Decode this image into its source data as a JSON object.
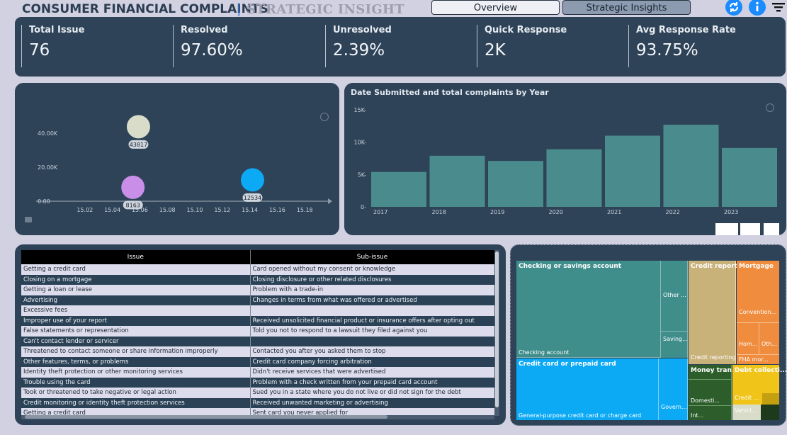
{
  "header": {
    "title": "CONSUMER FINANCIAL COMPLAINTS",
    "separator": "|",
    "subtitle": "STRATEGIC INSIGHT",
    "nav": {
      "overview": "Overview",
      "strategic": "Strategic Insights"
    },
    "icons": [
      "refresh-icon",
      "info-icon",
      "filter-icon"
    ]
  },
  "kpis": [
    {
      "label": "Total Issue",
      "value": "76"
    },
    {
      "label": "Resolved",
      "value": "97.60%"
    },
    {
      "label": "Unresolved",
      "value": "2.39%"
    },
    {
      "label": "Quick Response",
      "value": "2K"
    },
    {
      "label": "Avg Response Rate",
      "value": "93.75%"
    }
  ],
  "chart_data": [
    {
      "type": "scatter",
      "y_ticks": [
        "40.00K",
        "20.00K",
        "0.00"
      ],
      "x_ticks": [
        "15.02",
        "15.04",
        "15.06",
        "15.08",
        "15.10",
        "15.12",
        "15.14",
        "15.16",
        "15.18"
      ],
      "points": [
        {
          "x": 15.059,
          "y": 43817,
          "label": "43817",
          "color": "#d9dcc9"
        },
        {
          "x": 15.055,
          "y": 8163,
          "label": "8163",
          "color": "#c98ee8"
        },
        {
          "x": 15.142,
          "y": 12534,
          "label": "12534",
          "color": "#0ca9f5"
        }
      ],
      "xlim": [
        15.0,
        15.2
      ],
      "ylim": [
        0,
        50000
      ]
    },
    {
      "type": "bar",
      "title": "Date Submitted and total complaints by Year",
      "categories": [
        "2017",
        "2018",
        "2019",
        "2020",
        "2021",
        "2022",
        "2023"
      ],
      "values": [
        5400,
        7900,
        7100,
        8900,
        11000,
        12700,
        9100
      ],
      "y_ticks": [
        "15K",
        "10K",
        "5K",
        "0"
      ],
      "ylim": [
        0,
        15000
      ],
      "bar_color": "#4a8c8e"
    }
  ],
  "table": {
    "headers": [
      "Issue",
      "Sub-issue"
    ],
    "rows": [
      [
        "Getting a credit card",
        "Card opened without my consent or knowledge"
      ],
      [
        "Closing on a mortgage",
        "Closing disclosure or other related disclosures"
      ],
      [
        "Getting a loan or lease",
        "Problem with a trade-in"
      ],
      [
        "Advertising",
        "Changes in terms from what was offered or advertised"
      ],
      [
        "Excessive fees",
        ""
      ],
      [
        "Improper use of your report",
        "Received unsolicited financial product or insurance offers after opting out"
      ],
      [
        "False statements or representation",
        "Told you not to respond to a lawsuit they filed against you"
      ],
      [
        "Can't contact lender or servicer",
        ""
      ],
      [
        "Threatened to contact someone or share information improperly",
        "Contacted you after you asked them to stop"
      ],
      [
        "Other features, terms, or problems",
        "Credit card company forcing arbitration"
      ],
      [
        "Identity theft protection or other monitoring services",
        "Didn't receive services that were advertised"
      ],
      [
        "Trouble using the card",
        "Problem with a check written from your prepaid card account"
      ],
      [
        "Took or threatened to take negative or legal action",
        "Sued you in a state where you do not live or did not sign for the debt"
      ],
      [
        "Credit monitoring or identity theft protection services",
        "Received unwanted marketing or advertising"
      ],
      [
        "Getting a credit card",
        "Sent card you never applied for"
      ]
    ]
  },
  "treemap": {
    "checking_title": "Checking or savings account",
    "checking_sub": "Checking account",
    "checking_other": "Other ...",
    "checking_saving": "Saving...",
    "credit_title": "Credit reporti...",
    "credit_sub": "Credit reporting",
    "mortgage_title": "Mortgage",
    "mortgage_conv": "Convention...",
    "mortgage_hom": "Hom...",
    "mortgage_oth": "Oth...",
    "mortgage_fha": "FHA mor...",
    "card_title": "Credit card or prepaid card",
    "card_sub": "General-purpose credit card or charge card",
    "card_gov": "Govern...",
    "money_title": "Money tran...",
    "money_dom": "Domesti...",
    "money_int": "Int...",
    "debt_title": "Debt collecti...",
    "debt_credit": "Credit ...",
    "vehicle": "Vehicl...",
    "colors": {
      "checking": "#3f8e8c",
      "credit_reporting": "#c9b27a",
      "mortgage": "#ef8c3e",
      "credit_card": "#0ca9f5",
      "money_transfer": "#2c5d2a",
      "debt": "#f0c419",
      "vehicle": "#d9dcc9"
    }
  }
}
